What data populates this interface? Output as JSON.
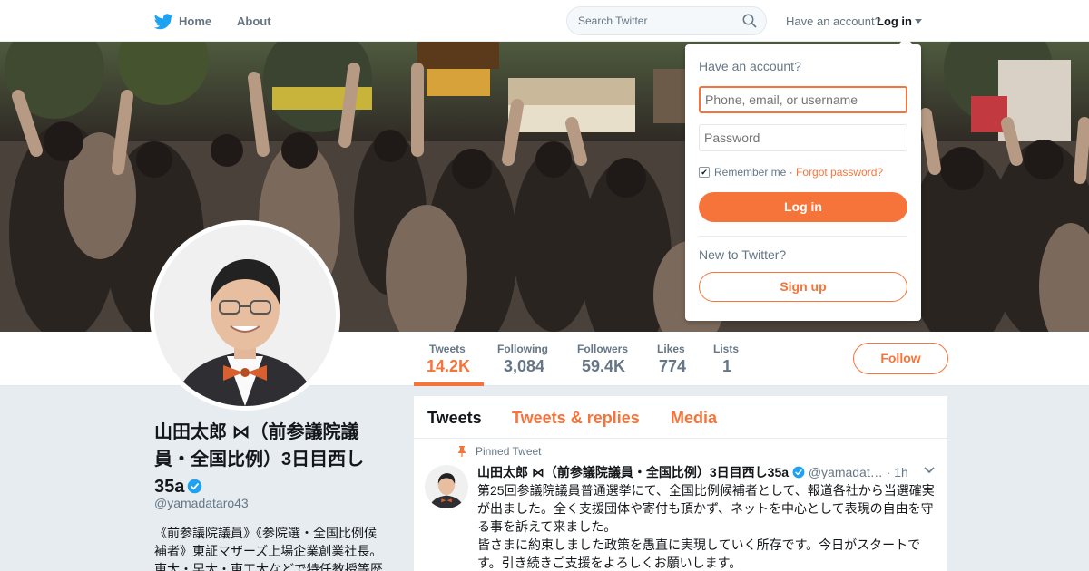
{
  "nav": {
    "home_label": "Home",
    "about_label": "About",
    "search_placeholder": "Search Twitter",
    "have_account": "Have an account?",
    "login_label": "Log in"
  },
  "stats": {
    "tweets": {
      "label": "Tweets",
      "value": "14.2K"
    },
    "following": {
      "label": "Following",
      "value": "3,084"
    },
    "followers": {
      "label": "Followers",
      "value": "59.4K"
    },
    "likes": {
      "label": "Likes",
      "value": "774"
    },
    "lists": {
      "label": "Lists",
      "value": "1"
    },
    "follow_label": "Follow"
  },
  "profile": {
    "name": "山田太郎 ⋈（前参議院議員・全国比例）3日目西し35a",
    "handle": "@yamadataro43",
    "bio": "《前参議院議員》《参院選・全国比例候補者》東証マザーズ上場企業創業社長。東大・早大・東工大などで特任教授等歴"
  },
  "timeline": {
    "tabs": [
      "Tweets",
      "Tweets & replies",
      "Media"
    ],
    "pinned_label": "Pinned Tweet",
    "tweet": {
      "name": "山田太郎 ⋈（前参議院議員・全国比例）3日目西し35a",
      "handle": "@yamadat…",
      "time": "· 1h",
      "body": "第25回参議院議員普通選挙にて、全国比例候補者として、報道各社から当選確実が出ました。全く支援団体や寄付も頂かず、ネットを中心として表現の自由を守る事を訴えて来ました。\n皆さまに約束しました政策を愚直に実現していく所存です。今日がスタートです。引き続きご支援をよろしくお願いします。"
    }
  },
  "login_dropdown": {
    "title": "Have an account?",
    "username_placeholder": "Phone, email, or username",
    "password_placeholder": "Password",
    "remember_label": "Remember me",
    "separator": " · ",
    "forgot_label": "Forgot password?",
    "login_button": "Log in",
    "new_label": "New to Twitter?",
    "signup_button": "Sign up"
  },
  "colors": {
    "accent": "#f6743a",
    "verified": "#1da1f2",
    "twitter_blue": "#1da1f2"
  },
  "icons": [
    "twitter-bird-icon",
    "search-icon",
    "caret-down-icon",
    "verified-icon",
    "pin-icon",
    "chevron-down-icon",
    "checkbox-icon"
  ]
}
